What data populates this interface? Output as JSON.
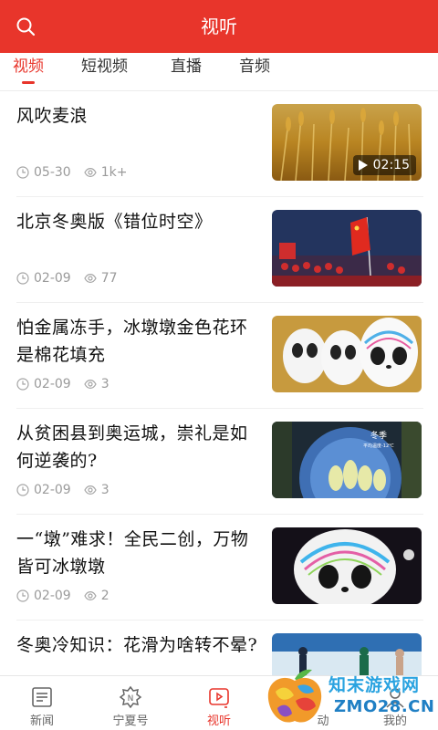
{
  "header": {
    "title": "视听",
    "search_icon": "search-icon",
    "bg_color": "#e8352b"
  },
  "tabs": [
    {
      "label": "视频",
      "active": true
    },
    {
      "label": "短视频",
      "active": false
    },
    {
      "label": "直播",
      "active": false
    },
    {
      "label": "音频",
      "active": false
    }
  ],
  "items": [
    {
      "title": "风吹麦浪",
      "date": "05-30",
      "views": "1k+",
      "duration": "02:15"
    },
    {
      "title": "北京冬奥版《错位时空》",
      "date": "02-09",
      "views": "77"
    },
    {
      "title": "怕金属冻手，冰墩墩金色花环是棉花填充",
      "date": "02-09",
      "views": "3"
    },
    {
      "title": "从贫困县到奥运城，崇礼是如何逆袭的?",
      "date": "02-09",
      "views": "3"
    },
    {
      "title": "一“墩”难求！全民二创，万物皆可冰墩墩",
      "date": "02-09",
      "views": "2"
    },
    {
      "title": "冬奥冷知识：花滑为啥转不晕?"
    }
  ],
  "thumbnail_text": {
    "thumb4_season": "冬季",
    "thumb4_temp": "平均温度-12℃"
  },
  "bottom_nav": [
    {
      "label": "新闻",
      "icon": "news-icon",
      "active": false
    },
    {
      "label": "宁夏号",
      "icon": "ningxia-hao-icon",
      "active": false
    },
    {
      "label": "视听",
      "icon": "video-icon",
      "active": true
    },
    {
      "label": "动",
      "icon": "activity-icon",
      "active": false
    },
    {
      "label": "我的",
      "icon": "user-icon",
      "active": false
    }
  ],
  "watermark": {
    "line1": "知末游戏网",
    "line2": "ZMO28.CN"
  },
  "colors": {
    "accent": "#e8352b",
    "meta": "#9a9a9a"
  }
}
